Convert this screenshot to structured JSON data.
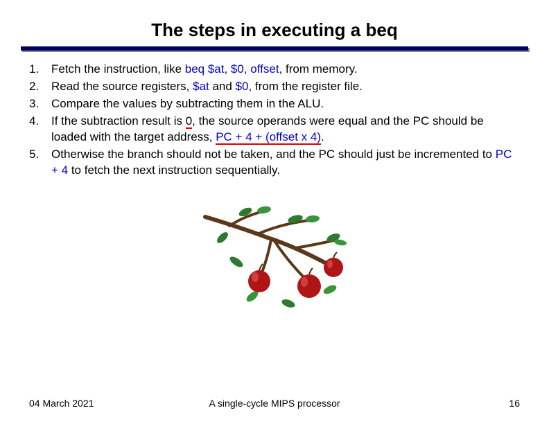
{
  "title": "The steps in executing a beq",
  "steps": [
    {
      "prefix": "Fetch the instruction, like ",
      "code": "beq $at, $0, offset",
      "suffix": ", from memory."
    },
    {
      "prefix": "Read the source registers, ",
      "reg1": "$at",
      "mid": " and ",
      "reg2": "$0",
      "suffix": ", from the register file."
    },
    {
      "text": "Compare the values by subtracting them in the ALU."
    },
    {
      "p1": "If the subtraction result is ",
      "zero": "0",
      "p2": ", the source operands were equal and the PC should be loaded with the target address, ",
      "expr": "PC + 4 + (offset x 4)",
      "p3": "."
    },
    {
      "p1": "Otherwise the branch should not be taken, and the PC should just be incremented to ",
      "expr": "PC + 4",
      "p2": " to fetch the next instruction sequentially."
    }
  ],
  "footer": {
    "date": "04 March 2021",
    "subject": "A single-cycle MIPS processor",
    "page": "16"
  }
}
